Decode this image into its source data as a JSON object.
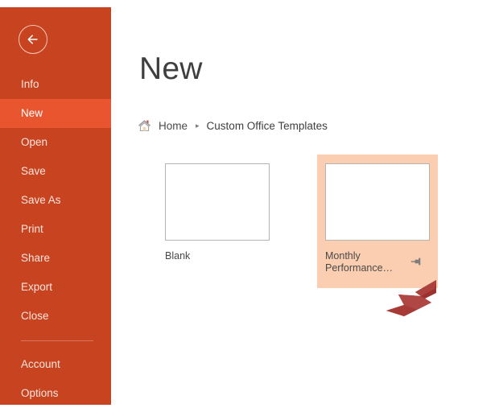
{
  "window": {
    "app": "PowerPoint",
    "screen": "Backstage New"
  },
  "sidebar": {
    "back_button": {
      "icon": "back-arrow-icon",
      "label": "Back"
    },
    "items": [
      {
        "label": "Info",
        "active": false
      },
      {
        "label": "New",
        "active": true
      },
      {
        "label": "Open",
        "active": false
      },
      {
        "label": "Save",
        "active": false
      },
      {
        "label": "Save As",
        "active": false
      },
      {
        "label": "Print",
        "active": false
      },
      {
        "label": "Share",
        "active": false
      },
      {
        "label": "Export",
        "active": false
      },
      {
        "label": "Close",
        "active": false
      }
    ],
    "footer_items": [
      {
        "label": "Account"
      },
      {
        "label": "Options"
      }
    ],
    "colors": {
      "background": "#c8431f",
      "active_background": "#e8552f",
      "text": "#fbe6df",
      "divider": "#d9765a"
    }
  },
  "main": {
    "title": "New",
    "breadcrumb": {
      "home_icon": "home-icon",
      "home_label": "Home",
      "separator": "▸",
      "current": "Custom Office Templates"
    },
    "templates": [
      {
        "name": "Blank",
        "selected": false,
        "pinned": false
      },
      {
        "name_line1": "Monthly",
        "name_line2": "Performance…",
        "selected": true,
        "pinned": true,
        "pin_icon": "pin-icon",
        "highlight_color": "#fbceb1"
      }
    ]
  },
  "annotation": {
    "pointer": {
      "icon": "pointer-arrow-icon",
      "color": "#a83a36",
      "points_at": "Monthly Performance..."
    }
  }
}
